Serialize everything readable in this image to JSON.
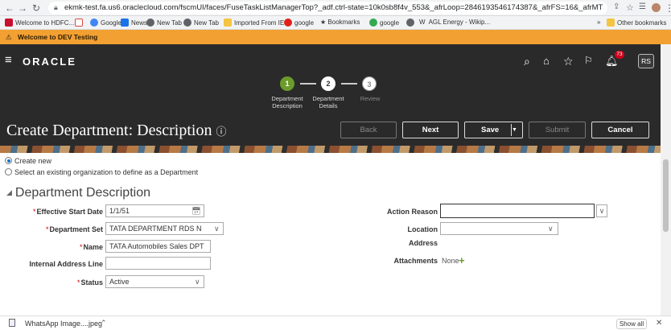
{
  "browser": {
    "url": "ekmk-test.fa.us6.oraclecloud.com/fscmUI/faces/FuseTaskListManagerTop?_adf.ctrl-state=10k0sb8f4v_553&_afrLoop=2846193546174387&_afrFS=16&_afrMT=scre...",
    "bookmarks": [
      "Welcome to HDFC...",
      "Gmail",
      "Google",
      "News",
      "New Tab",
      "New Tab",
      "Imported From IE",
      "google",
      "Bookmarks",
      "google",
      "W",
      "AGL Energy - Wikip...",
      "»",
      "Other bookmarks"
    ],
    "banner": "Welcome to DEV Testing"
  },
  "header": {
    "logo": "ORACLE",
    "avatar": "RS",
    "notification_count": "73"
  },
  "train": {
    "steps": [
      {
        "num": "1",
        "label1": "Department",
        "label2": "Description"
      },
      {
        "num": "2",
        "label1": "Department",
        "label2": "Details"
      },
      {
        "num": "3",
        "label1": "Review",
        "label2": ""
      }
    ]
  },
  "page": {
    "title": "Create Department: Description",
    "buttons": {
      "back": "Back",
      "next": "Next",
      "save": "Save",
      "submit": "Submit",
      "cancel": "Cancel"
    }
  },
  "options": {
    "create_new": "Create new",
    "select_existing": "Select an existing organization to define as a Department"
  },
  "section": {
    "title": "Department Description"
  },
  "form": {
    "effective_start_date": {
      "label": "Effective Start Date",
      "value": "1/1/51"
    },
    "department_set": {
      "label": "Department Set",
      "value": "TATA DEPARTMENT RDS N"
    },
    "name": {
      "label": "Name",
      "value": "TATA Automobiles Sales DPT"
    },
    "internal_address_line": {
      "label": "Internal Address Line",
      "value": ""
    },
    "status": {
      "label": "Status",
      "value": "Active"
    },
    "action_reason": {
      "label": "Action Reason",
      "value": ""
    },
    "location": {
      "label": "Location",
      "value": ""
    },
    "address": {
      "label": "Address"
    },
    "attachments": {
      "label": "Attachments",
      "value": "None"
    }
  },
  "downloads": {
    "file": "WhatsApp Image....jpeg",
    "show_all": "Show all"
  }
}
